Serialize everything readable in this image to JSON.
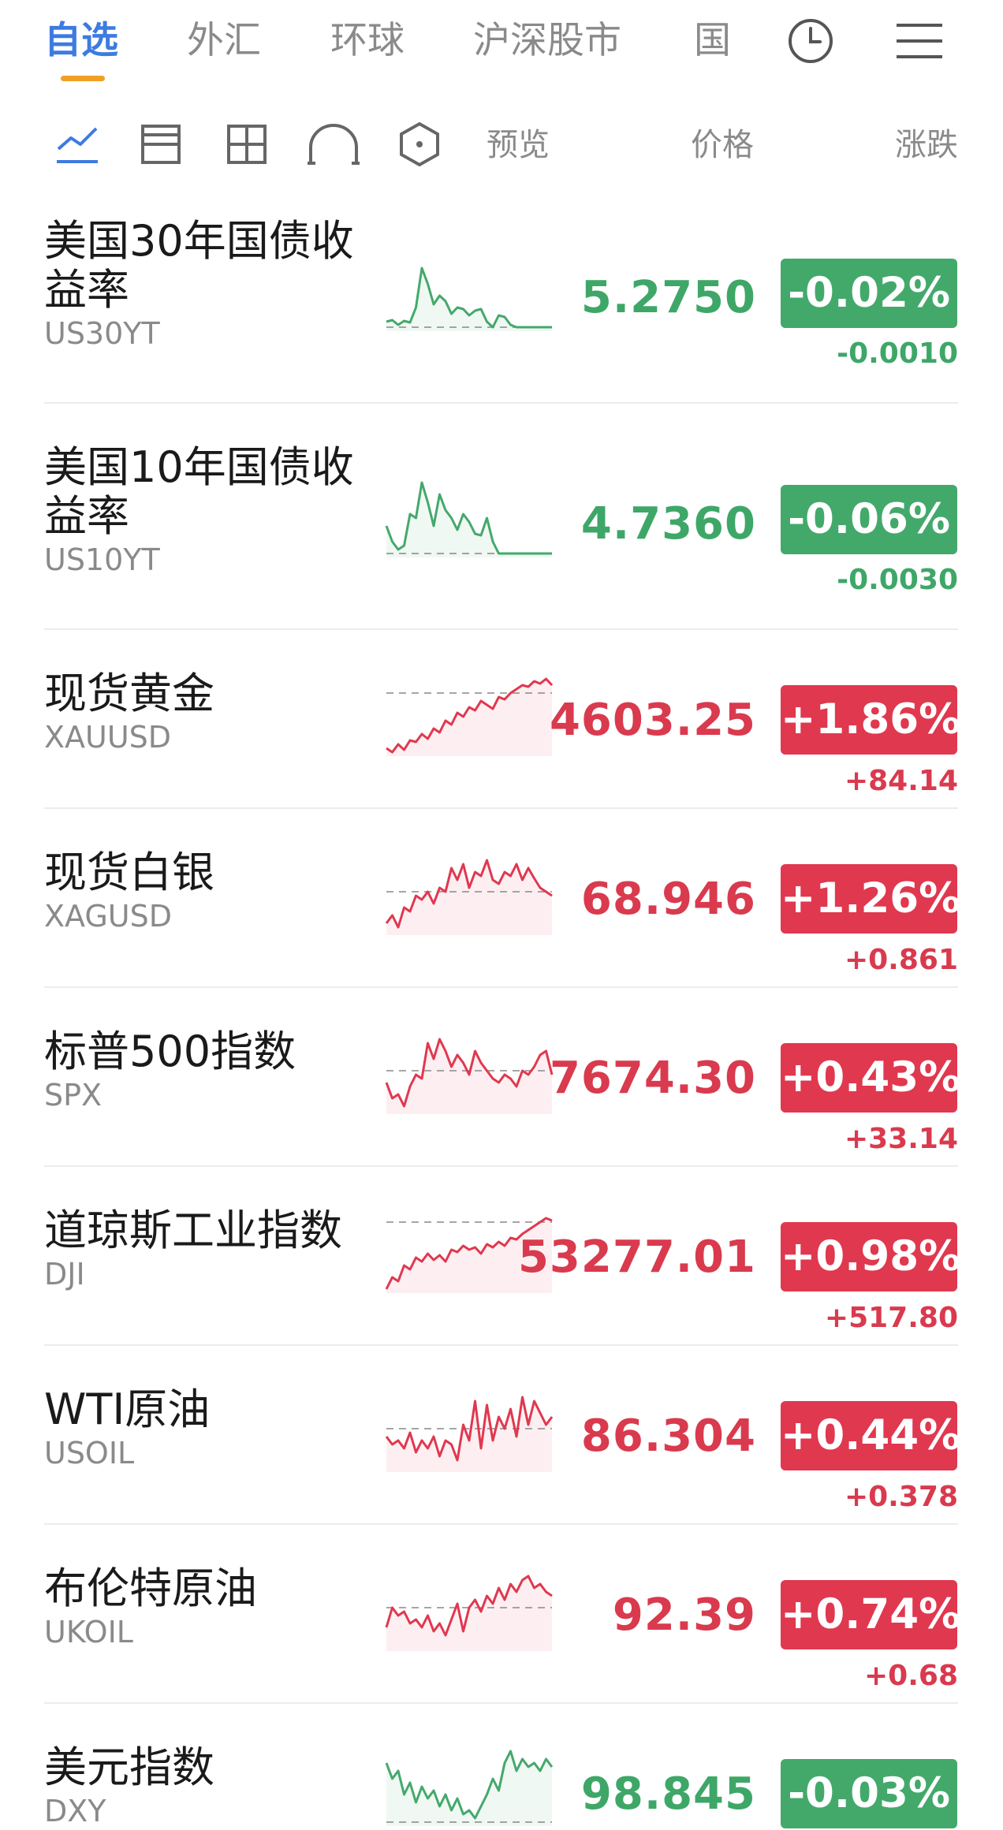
{
  "tabs": [
    {
      "label": "自选",
      "active": true
    },
    {
      "label": "外汇",
      "active": false
    },
    {
      "label": "环球",
      "active": false
    },
    {
      "label": "沪深股市",
      "active": false
    },
    {
      "label": "国",
      "active": false
    }
  ],
  "top_icons": [
    "clock-icon",
    "menu-icon"
  ],
  "view_icons": [
    "line-chart-icon",
    "two-row-layout-icon",
    "grid-layout-icon",
    "arc-chart-icon",
    "hexagon-icon"
  ],
  "columns": {
    "preview": "预览",
    "price": "价格",
    "change": "涨跌"
  },
  "colors": {
    "up": "#e0384f",
    "down": "#43a96b",
    "accent": "#3d7be0",
    "underline": "#f0a023"
  },
  "quotes": [
    {
      "name": "美国30年国债收益率",
      "code": "US30YT",
      "price": "5.2750",
      "pct": "-0.02%",
      "change": "-0.0010",
      "dir": "down",
      "spark": [
        12,
        14,
        8,
        13,
        11,
        30,
        80,
        60,
        34,
        45,
        38,
        22,
        30,
        28,
        20,
        26,
        28,
        12,
        5,
        20,
        18,
        8,
        5,
        5,
        5,
        5,
        5,
        5,
        5
      ]
    },
    {
      "name": "美国10年国债收益率",
      "code": "US10YT",
      "price": "4.7360",
      "pct": "-0.06%",
      "change": "-0.0030",
      "dir": "down",
      "spark": [
        40,
        20,
        10,
        15,
        55,
        50,
        95,
        70,
        40,
        80,
        60,
        50,
        35,
        55,
        45,
        30,
        28,
        50,
        20,
        5,
        5,
        5,
        5,
        5,
        5,
        5,
        5,
        5,
        5
      ]
    },
    {
      "name": "现货黄金",
      "code": "XAUUSD",
      "price": "4603.25",
      "pct": "+1.86%",
      "change": "+84.14",
      "dir": "up",
      "spark": [
        10,
        5,
        15,
        8,
        20,
        18,
        28,
        22,
        35,
        30,
        45,
        40,
        55,
        50,
        62,
        58,
        70,
        65,
        60,
        75,
        72,
        80,
        85,
        90,
        88,
        95,
        92,
        98,
        90
      ]
    },
    {
      "name": "现货白银",
      "code": "XAGUSD",
      "price": "68.946",
      "pct": "+1.26%",
      "change": "+0.861",
      "dir": "up",
      "spark": [
        15,
        25,
        10,
        35,
        30,
        50,
        45,
        55,
        40,
        60,
        55,
        85,
        70,
        90,
        60,
        80,
        75,
        95,
        70,
        65,
        80,
        75,
        90,
        70,
        85,
        72,
        60,
        55,
        50
      ]
    },
    {
      "name": "标普500指数",
      "code": "SPX",
      "price": "7674.30",
      "pct": "+0.43%",
      "change": "+33.14",
      "dir": "up",
      "spark": [
        40,
        20,
        25,
        10,
        35,
        50,
        45,
        90,
        70,
        95,
        80,
        60,
        75,
        65,
        50,
        80,
        65,
        55,
        45,
        40,
        50,
        45,
        35,
        55,
        50,
        60,
        75,
        80,
        50
      ]
    },
    {
      "name": "道琼斯工业指数",
      "code": "DJI",
      "price": "53277.01",
      "pct": "+0.98%",
      "change": "+517.80",
      "dir": "up",
      "spark": [
        5,
        20,
        15,
        35,
        30,
        45,
        40,
        50,
        42,
        48,
        40,
        55,
        52,
        60,
        55,
        58,
        50,
        62,
        58,
        65,
        60,
        70,
        68,
        75,
        80,
        85,
        90,
        95,
        92
      ]
    },
    {
      "name": "WTI原油",
      "code": "USOIL",
      "price": "86.304",
      "pct": "+0.44%",
      "change": "+0.378",
      "dir": "up",
      "spark": [
        45,
        35,
        40,
        30,
        50,
        25,
        40,
        30,
        45,
        20,
        40,
        35,
        15,
        60,
        40,
        90,
        30,
        85,
        40,
        70,
        55,
        80,
        45,
        95,
        60,
        90,
        75,
        60,
        70
      ]
    },
    {
      "name": "布伦特原油",
      "code": "UKOIL",
      "price": "92.39",
      "pct": "+0.74%",
      "change": "+0.68",
      "dir": "up",
      "spark": [
        30,
        55,
        45,
        50,
        35,
        40,
        30,
        45,
        25,
        35,
        20,
        40,
        60,
        25,
        55,
        65,
        50,
        70,
        60,
        80,
        65,
        85,
        75,
        90,
        95,
        80,
        85,
        75,
        70
      ]
    },
    {
      "name": "美元指数",
      "code": "DXY",
      "price": "98.845",
      "pct": "-0.03%",
      "change": "",
      "dir": "down",
      "spark": [
        80,
        60,
        70,
        40,
        55,
        30,
        50,
        35,
        45,
        25,
        40,
        20,
        35,
        15,
        20,
        10,
        25,
        40,
        60,
        45,
        80,
        95,
        70,
        85,
        75,
        80,
        70,
        85,
        75
      ]
    }
  ]
}
